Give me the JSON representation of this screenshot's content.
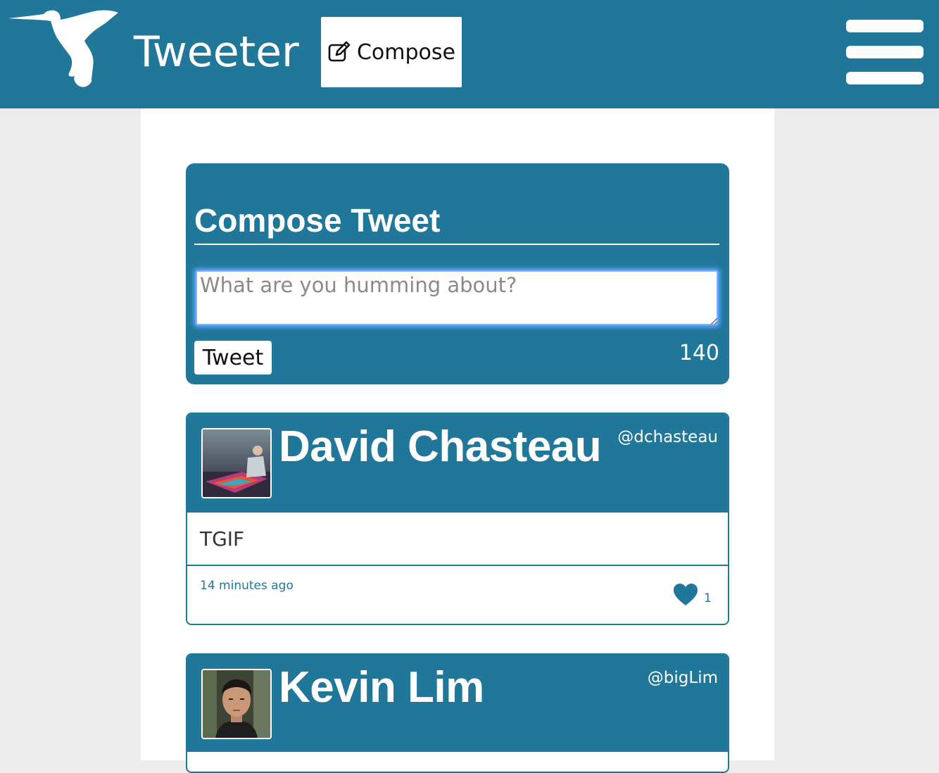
{
  "nav": {
    "brand": "Tweeter",
    "compose_label": "Compose",
    "logo_icon": "hummingbird-icon",
    "compose_icon": "edit-icon",
    "menu_icon": "hamburger-menu-icon"
  },
  "compose": {
    "title": "Compose Tweet",
    "placeholder": "What are you humming about?",
    "value": "",
    "submit_label": "Tweet",
    "char_count": "140"
  },
  "tweets": [
    {
      "name": "David Chasteau",
      "handle": "@dchasteau",
      "text": "TGIF",
      "time": "14 minutes ago",
      "likes": "1"
    },
    {
      "name": "Kevin Lim",
      "handle": "@bigLim"
    }
  ],
  "colors": {
    "primary": "#21779a",
    "page_background": "#ececec",
    "container_background": "#ffffff"
  }
}
